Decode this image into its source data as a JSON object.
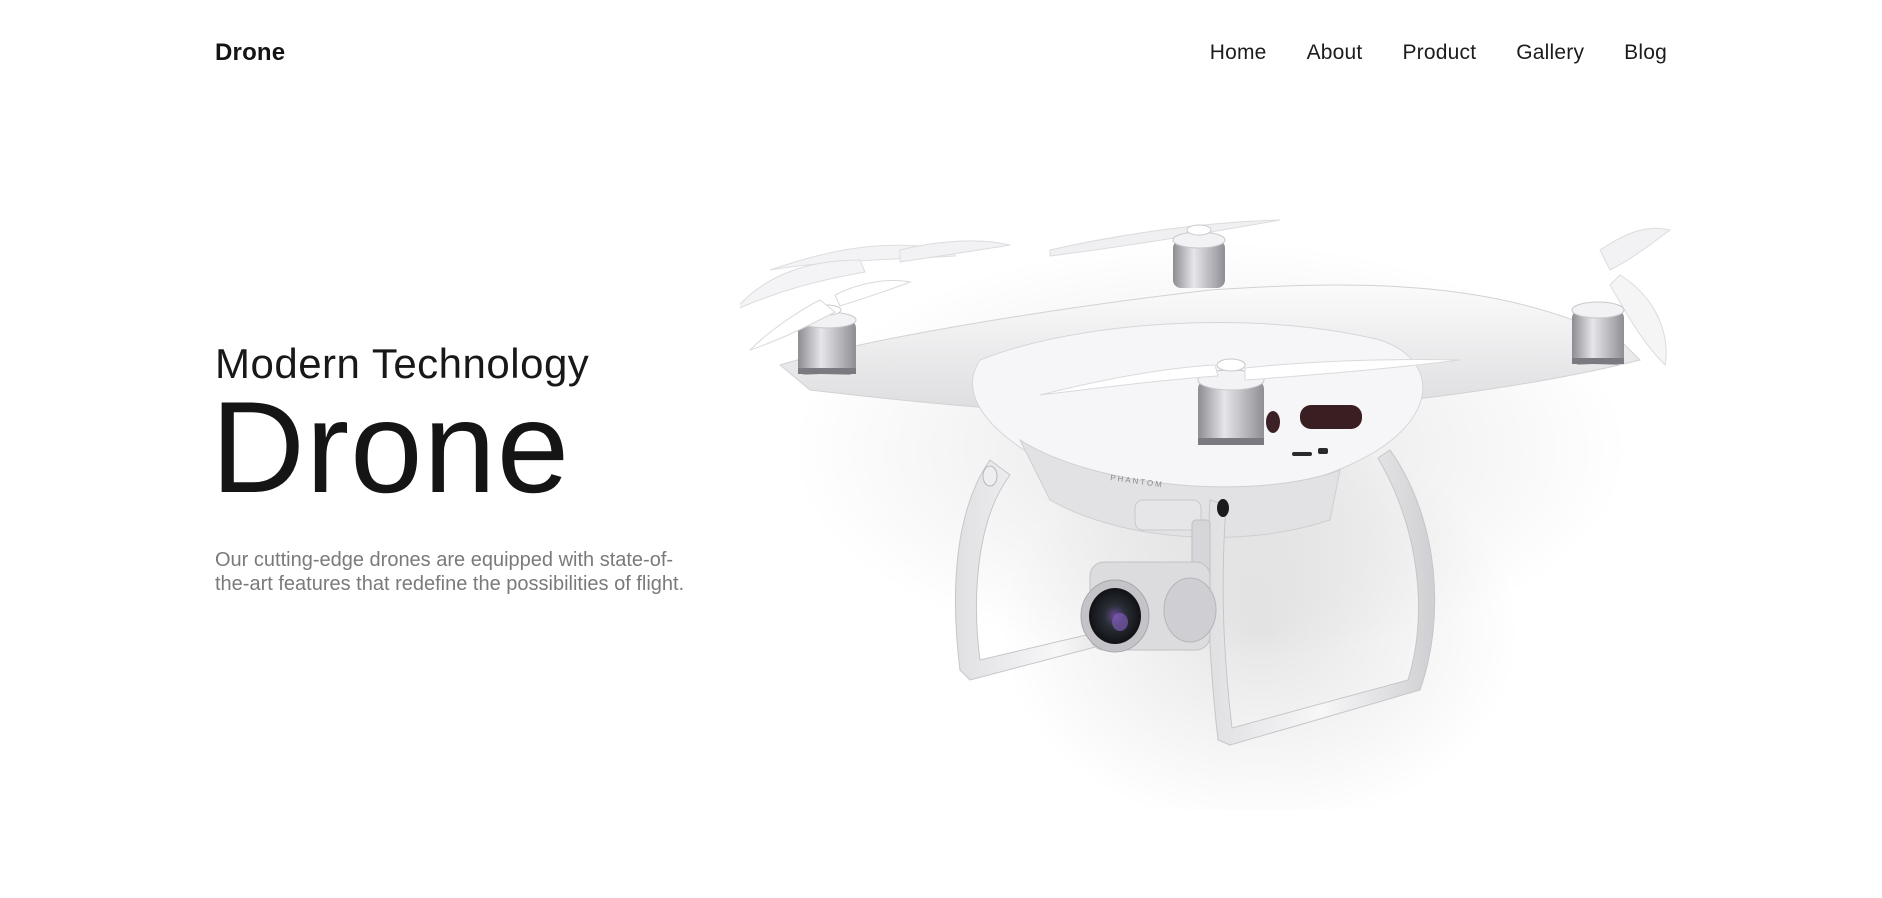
{
  "header": {
    "logo": "Drone",
    "nav": [
      {
        "label": "Home"
      },
      {
        "label": "About"
      },
      {
        "label": "Product"
      },
      {
        "label": "Gallery"
      },
      {
        "label": "Blog"
      }
    ]
  },
  "hero": {
    "subtitle": "Modern Technology",
    "title": "Drone",
    "description": "Our cutting-edge drones are equipped with state-of-the-art features that redefine the possibilities of flight."
  },
  "image": {
    "subject": "white quadcopter drone with camera gimbal",
    "icon": "drone-image",
    "body_text": "PHANTOM"
  },
  "colors": {
    "background": "#ffffff",
    "text": "#1a1a1a",
    "muted_text": "#7a7a7a",
    "drone_body": "#f2f2f4"
  }
}
